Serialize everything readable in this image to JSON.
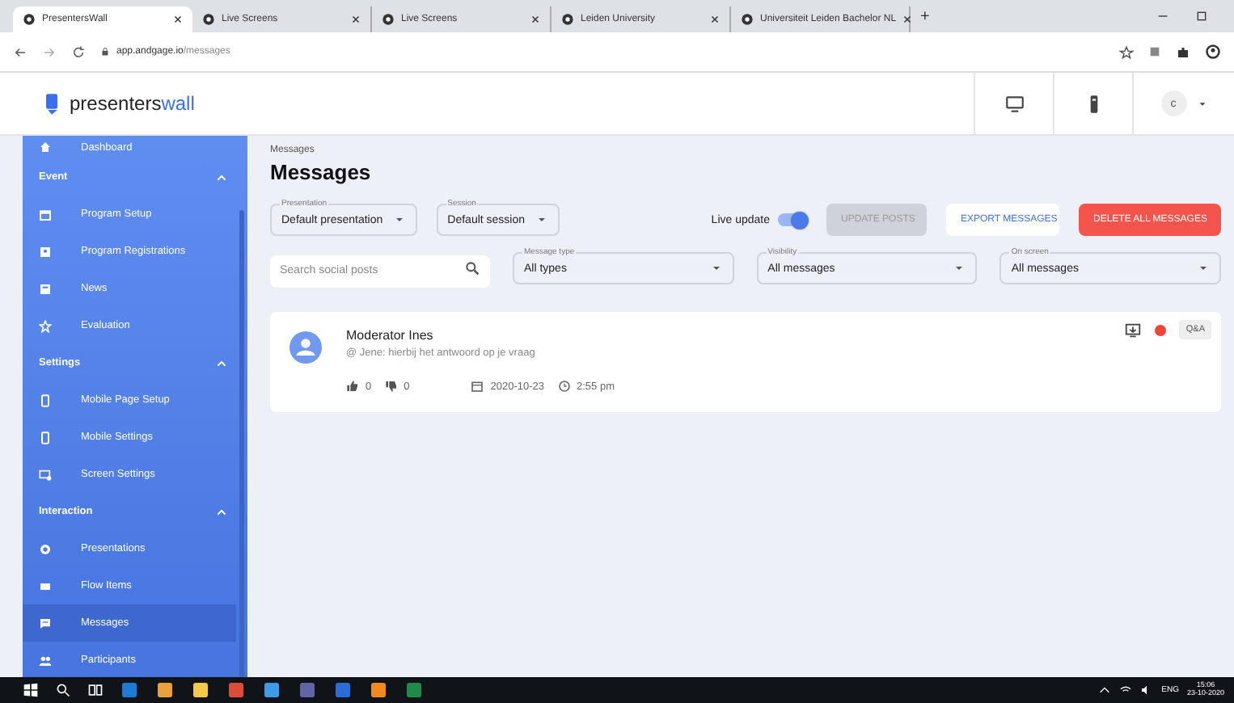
{
  "browser": {
    "tabs": [
      {
        "title": "PresentersWall",
        "selected": true
      },
      {
        "title": "Live Screens",
        "selected": false
      },
      {
        "title": "Live Screens",
        "selected": false
      },
      {
        "title": "Leiden University",
        "selected": false
      },
      {
        "title": "Universiteit Leiden Bachelor NL",
        "selected": false
      }
    ],
    "new_tab": "+",
    "url_host": "app.andgage.io",
    "url_path": "/messages"
  },
  "app_header": {
    "logo_text": "presenters",
    "logo_accent": "wall",
    "avatar": "c"
  },
  "sidebar": {
    "items": [
      {
        "kind": "item",
        "label": "Dashboard",
        "selected": false
      },
      {
        "kind": "section",
        "label": "Event",
        "expanded": true
      },
      {
        "kind": "item",
        "label": "Program Setup",
        "selected": false
      },
      {
        "kind": "item",
        "label": "Program Registrations",
        "selected": false
      },
      {
        "kind": "item",
        "label": "News",
        "selected": false
      },
      {
        "kind": "item",
        "label": "Evaluation",
        "selected": false
      },
      {
        "kind": "section",
        "label": "Settings",
        "expanded": true
      },
      {
        "kind": "item",
        "label": "Mobile Page Setup",
        "selected": false
      },
      {
        "kind": "item",
        "label": "Mobile Settings",
        "selected": false
      },
      {
        "kind": "item",
        "label": "Screen Settings",
        "selected": false
      },
      {
        "kind": "section",
        "label": "Interaction",
        "expanded": true
      },
      {
        "kind": "item",
        "label": "Presentations",
        "selected": false
      },
      {
        "kind": "item",
        "label": "Flow Items",
        "selected": false
      },
      {
        "kind": "item",
        "label": "Messages",
        "selected": true
      },
      {
        "kind": "item",
        "label": "Participants",
        "selected": false
      }
    ]
  },
  "breadcrumb": "Messages",
  "page_title": "Messages",
  "filters_top": [
    {
      "label": "Presentation",
      "value": "Default presentation"
    },
    {
      "label": "Session",
      "value": "Default session"
    }
  ],
  "live_update": {
    "label": "Live update",
    "on": true
  },
  "buttons": [
    {
      "kind": "disabled",
      "label": "UPDATE POSTS"
    },
    {
      "kind": "outline",
      "label": "EXPORT MESSAGES"
    },
    {
      "kind": "danger",
      "label": "DELETE ALL MESSAGES"
    }
  ],
  "search": {
    "placeholder": "Search social posts"
  },
  "filters": [
    {
      "label": "Message type",
      "value": "All types"
    },
    {
      "label": "Visibility",
      "value": "All messages"
    },
    {
      "label": "On screen",
      "value": "All messages"
    }
  ],
  "messages": [
    {
      "author": "Moderator Ines",
      "text": "@ Jene: hierbij het antwoord op je vraag",
      "likes": "0",
      "dislikes": "0",
      "date": "2020-10-23",
      "time": "2:55 pm",
      "tag": "Q&A",
      "color": "#f44336"
    }
  ],
  "taskbar": {
    "lang": "ENG",
    "time": "15:06",
    "date": "23-10-2020"
  }
}
